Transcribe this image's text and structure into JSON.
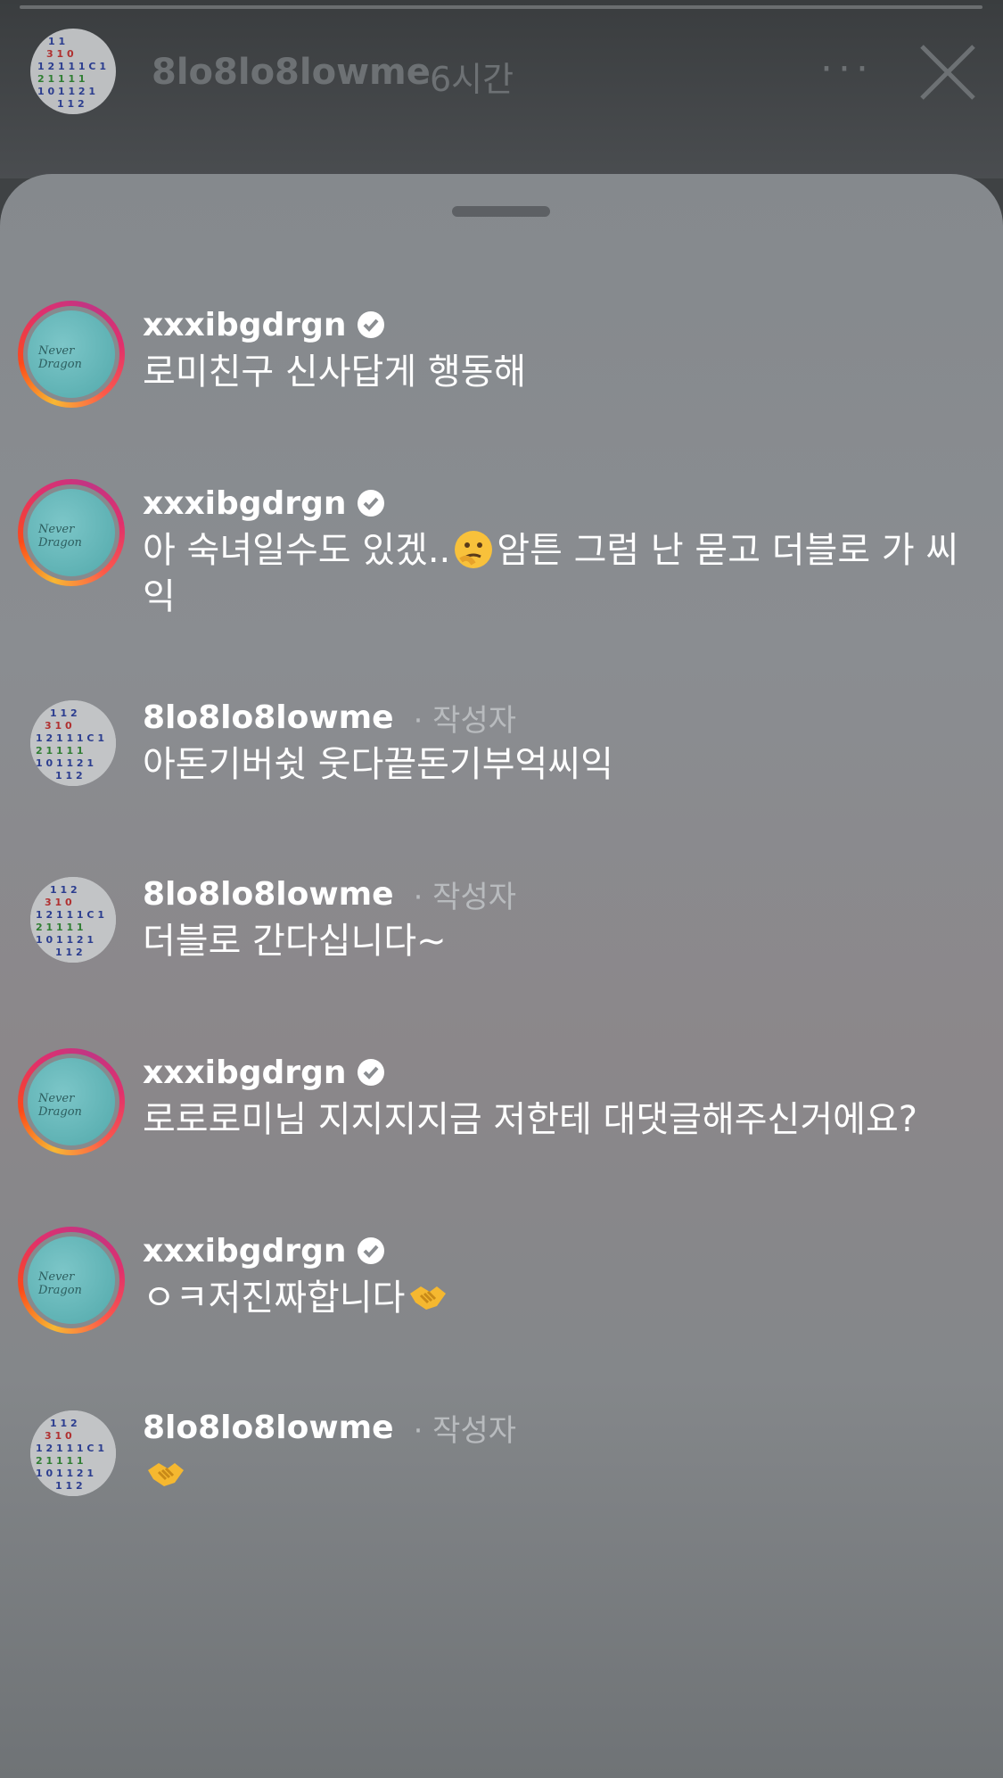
{
  "story_header": {
    "username": "8lo8lo8lowme",
    "time": "6시간",
    "more_label": "···",
    "close_icon": "close-icon"
  },
  "sheet": {
    "handle_icon": "drag-handle"
  },
  "comments": [
    {
      "username": "xxxibgdrgn",
      "verified": true,
      "author_tag": "",
      "text": "로미친구 신사답게 행동해"
    },
    {
      "username": "xxxibgdrgn",
      "verified": true,
      "author_tag": "",
      "text_before": "아 숙녀일수도 있겠..",
      "text_after": "암튼 그럼 난 묻고 더블로 가 씨익",
      "emoji": "thinking-face-emoji"
    },
    {
      "username": "8lo8lo8lowme",
      "verified": false,
      "author_tag": "· 작성자",
      "text": "아돈기버쉿 웃다끝돈기부억씨익"
    },
    {
      "username": "8lo8lo8lowme",
      "verified": false,
      "author_tag": "· 작성자",
      "text": "더블로 간다십니다~"
    },
    {
      "username": "xxxibgdrgn",
      "verified": true,
      "author_tag": "",
      "text": "로로로미님 지지지지금 저한테 대댓글해주신거에요?"
    },
    {
      "username": "xxxibgdrgn",
      "verified": true,
      "author_tag": "",
      "text": "ㅇㅋ저진짜합니다",
      "emoji": "handshake-emoji"
    },
    {
      "username": "8lo8lo8lowme",
      "verified": false,
      "author_tag": "· 작성자",
      "text": "",
      "emoji": "handshake-emoji"
    }
  ],
  "colors": {
    "sheet_bg": "#888b8f",
    "ring_gradient": [
      "#f7b733",
      "#e1306c",
      "#c13584"
    ]
  }
}
